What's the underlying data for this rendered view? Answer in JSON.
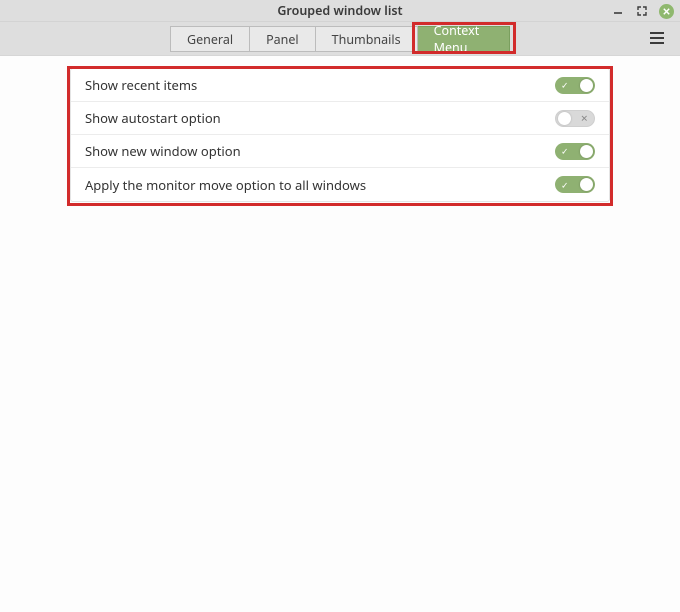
{
  "window": {
    "title": "Grouped window list"
  },
  "tabs": {
    "general": "General",
    "panel": "Panel",
    "thumbnails": "Thumbnails",
    "context_menu": "Context Menu"
  },
  "settings": {
    "show_recent": {
      "label": "Show recent items",
      "value": true
    },
    "show_autostart": {
      "label": "Show autostart option",
      "value": false
    },
    "show_new_window": {
      "label": "Show new window option",
      "value": true
    },
    "monitor_move_all": {
      "label": "Apply the monitor move option to all windows",
      "value": true
    }
  },
  "highlights": {
    "active_tab": "context_menu",
    "panel_outlined": true
  }
}
